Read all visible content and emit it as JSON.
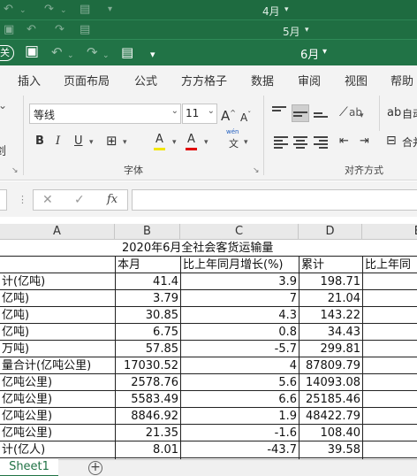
{
  "windows": {
    "back1_title": "4月",
    "back2_title": "5月",
    "main_title": "6月",
    "autosave_label": "关",
    "title_caret": "▾"
  },
  "ribbon_tabs": [
    "插入",
    "页面布局",
    "公式",
    "方方格子",
    "数据",
    "审阅",
    "视图",
    "帮助"
  ],
  "font": {
    "family": "等线",
    "size": "11",
    "grow_label": "A",
    "shrink_label": "A",
    "bold": "B",
    "italic": "I",
    "underline": "U",
    "wen_label": "wén",
    "wen_char": "文",
    "highlight_glyph": "A",
    "font_color_glyph": "A",
    "group_label": "字体"
  },
  "alignment": {
    "wrap_label": "自动",
    "merge_label": "合并",
    "group_label": "对齐方式"
  },
  "left_partial": {
    "label": "剑"
  },
  "formula_bar": {
    "cancel": "✕",
    "enter": "✓",
    "fx": "fx",
    "value": ""
  },
  "columns": [
    "A",
    "B",
    "C",
    "D",
    "E"
  ],
  "sheet": {
    "title": "2020年6月全社会客货运输量",
    "headers": [
      "",
      "本月",
      "比上年同月增长(%)",
      "累计",
      "比上年同"
    ],
    "rows": [
      [
        "计(亿吨)",
        "41.4",
        "3.9",
        "198.71"
      ],
      [
        "亿吨)",
        "3.79",
        "7",
        "21.04"
      ],
      [
        "亿吨)",
        "30.85",
        "4.3",
        "143.22"
      ],
      [
        "亿吨)",
        "6.75",
        "0.8",
        "34.43"
      ],
      [
        "万吨)",
        "57.85",
        "-5.7",
        "299.81"
      ],
      [
        "量合计(亿吨公里)",
        "17030.52",
        "4",
        "87809.79"
      ],
      [
        "亿吨公里)",
        "2578.76",
        "5.6",
        "14093.08"
      ],
      [
        "亿吨公里)",
        "5583.49",
        "6.6",
        "25185.46"
      ],
      [
        "亿吨公里)",
        "8846.92",
        "1.9",
        "48422.79"
      ],
      [
        "亿吨公里)",
        "21.35",
        "-1.6",
        "108.40"
      ],
      [
        "计(亿人)",
        "8.01",
        "-43.7",
        "39.58"
      ]
    ]
  },
  "sheet_tabs": [
    "Sheet1"
  ],
  "add_sheet": "+",
  "colors": {
    "excel_green": "#217346",
    "ribbon_bg": "#f3f3f3"
  },
  "icons": [
    "save-icon",
    "undo-icon",
    "redo-icon",
    "print-preview-icon",
    "customize-icon"
  ]
}
